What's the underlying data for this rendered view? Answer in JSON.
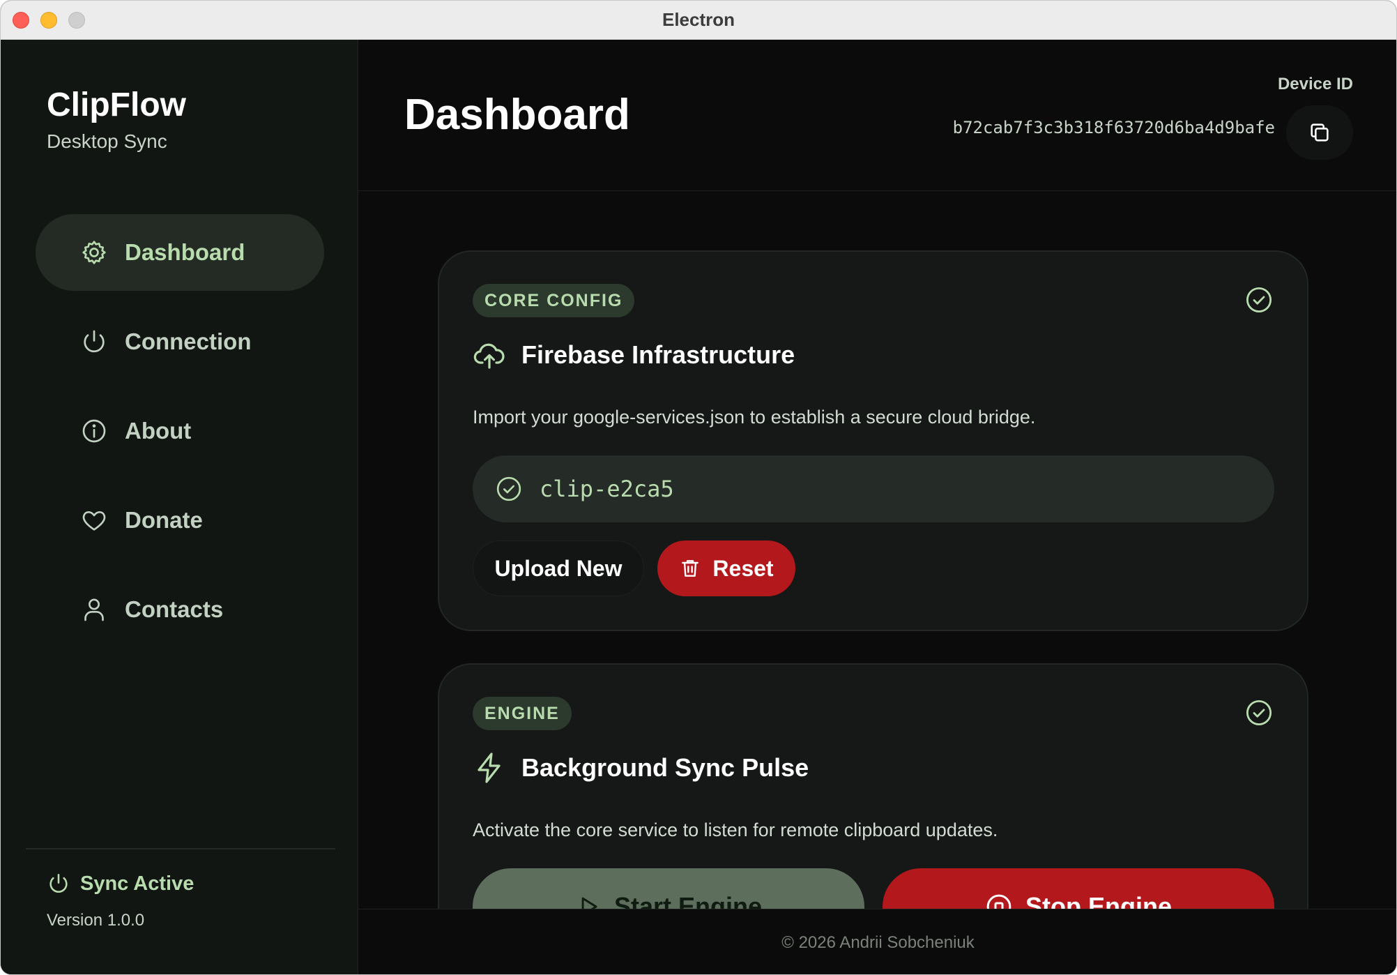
{
  "window": {
    "title": "Electron"
  },
  "brand": {
    "name": "ClipFlow",
    "subtitle": "Desktop Sync"
  },
  "sidebar": {
    "items": [
      {
        "label": "Dashboard",
        "icon": "gear-icon",
        "active": true
      },
      {
        "label": "Connection",
        "icon": "power-icon",
        "active": false
      },
      {
        "label": "About",
        "icon": "info-icon",
        "active": false
      },
      {
        "label": "Donate",
        "icon": "heart-icon",
        "active": false
      },
      {
        "label": "Contacts",
        "icon": "user-icon",
        "active": false
      }
    ],
    "status": "Sync Active",
    "version": "Version 1.0.0"
  },
  "header": {
    "title": "Dashboard",
    "device_label": "Device ID",
    "device_id": "b72cab7f3c3b318f63720d6ba4d9bafe"
  },
  "cards": {
    "config": {
      "badge": "CORE CONFIG",
      "title": "Firebase Infrastructure",
      "description": "Import your google-services.json to establish a secure cloud bridge.",
      "project": "clip-e2ca5",
      "upload_label": "Upload New",
      "reset_label": "Reset"
    },
    "engine": {
      "badge": "ENGINE",
      "title": "Background Sync Pulse",
      "description": "Activate the core service to listen for remote clipboard updates.",
      "start_label": "Start Engine",
      "stop_label": "Stop Engine"
    }
  },
  "footer": {
    "text": "© 2026 Andrii Sobcheniuk"
  },
  "colors": {
    "accent": "#b9dcaf",
    "danger": "#b3181c",
    "muted_green": "#5d6f5c",
    "background": "#0a0b0a"
  }
}
